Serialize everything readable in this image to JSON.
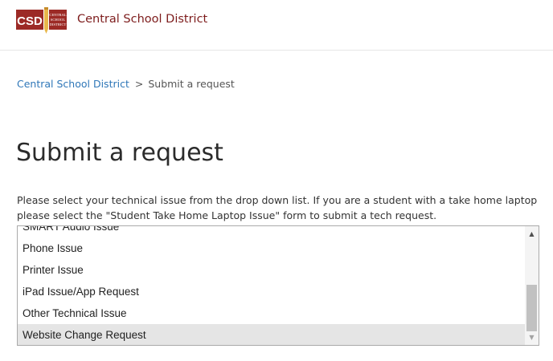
{
  "header": {
    "logo_text": "CSD",
    "logo_subtext": "CENTRAL SCHOOL DISTRICT",
    "brand_name": "Central School District",
    "colors": {
      "brand": "#7d1c1c",
      "logo_bg": "#9c2a26",
      "pencil": "#e8b84a"
    }
  },
  "breadcrumb": {
    "home_label": "Central School District",
    "separator": ">",
    "current_label": "Submit a request",
    "link_color": "#2f77b8"
  },
  "page": {
    "title": "Submit a request",
    "instructions": "Please select your technical issue from the drop down list. If you are a student with a take home laptop please select the \"Student Take Home Laptop Issue\" form to submit a tech request."
  },
  "request_type_list": {
    "options": [
      "SMART Audio Issue",
      "Phone Issue",
      "Printer Issue",
      "iPad Issue/App Request",
      "Other Technical Issue",
      "Website Change Request"
    ],
    "selected": "Website Change Request",
    "scroll_up_icon": "triangle-up-icon",
    "scroll_down_icon": "triangle-down-icon"
  }
}
